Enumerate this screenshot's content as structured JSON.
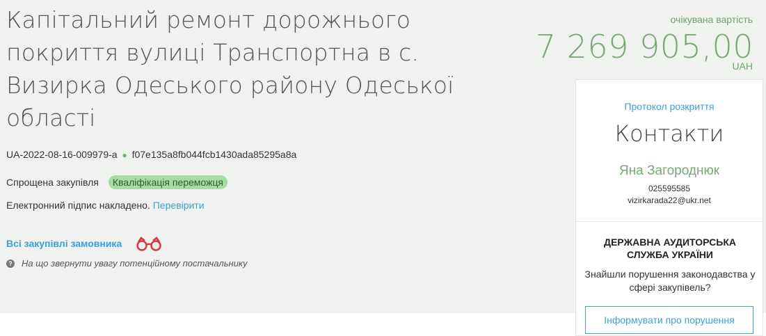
{
  "tender": {
    "title": "Капітальний ремонт дорожнього покриття вулиці Транспортна в с. Визирка Одеського району Одеської області",
    "id": "UA-2022-08-16-009979-a",
    "id_separator": "●",
    "hash": "f07e135a8fb044fcb1430ada85295a8a",
    "procedure_type": "Спрощена закупівля",
    "status_badge": "Кваліфікація переможця",
    "signature_text": "Електронний підпис накладено.",
    "signature_verify_link": "Перевірити",
    "all_purchases_link": "Всі закупівлі замовника",
    "attention_text": "На що звернути увагу потенційному постачальнику"
  },
  "price": {
    "label": "очікувана вартість",
    "value": "7 269 905,00",
    "currency": "UAH"
  },
  "card": {
    "protocol_link": "Протокол розкриття",
    "contacts_title": "Контакти",
    "contact_name": "Яна Загороднюк",
    "contact_phone": "025595585",
    "contact_email": "vizirkarada22@ukr.net",
    "audit_title": "ДЕРЖАВНА АУДИТОРСЬКА СЛУЖБА УКРАЇНИ",
    "audit_text": "Знайшли порушення законодавства у сфері закупівель?",
    "report_button": "Інформувати про порушення"
  },
  "icons": {
    "binoculars": "binoculars-icon",
    "question": "question-circle-icon"
  },
  "colors": {
    "accent_green": "#79a874",
    "link_blue": "#3d9fd6",
    "badge_green": "#a7dba5",
    "binoculars_red": "#d9373e"
  }
}
